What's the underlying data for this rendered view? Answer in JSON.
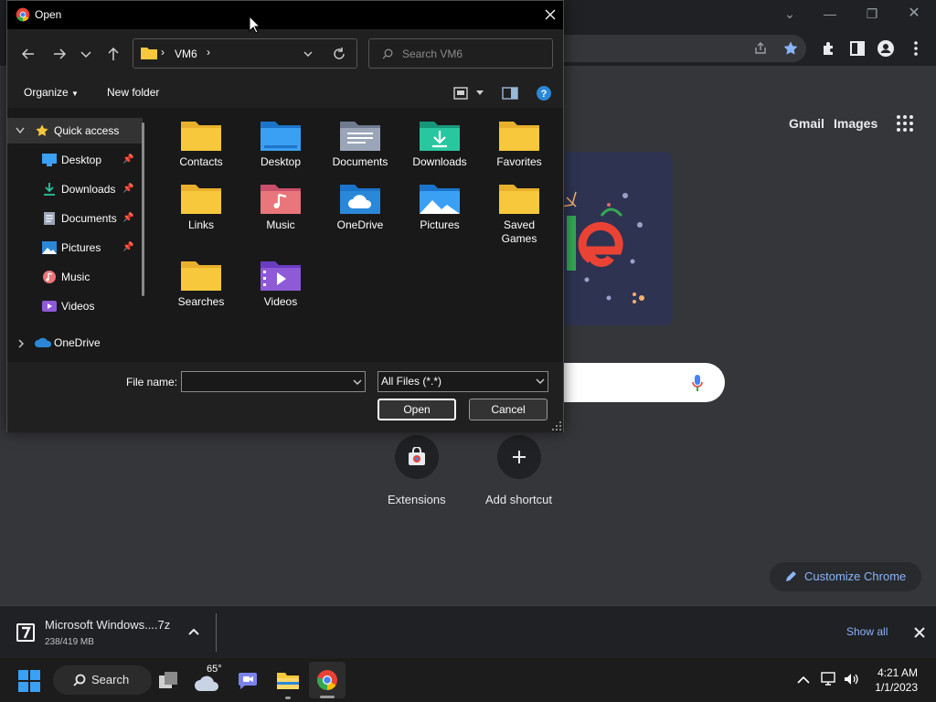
{
  "colors": {
    "accent_blue": "#8ab4f8",
    "folder_yellow": "#f8c83c",
    "chrome_dark": "#202124",
    "dialog_bg": "#202020",
    "pane_bg": "#191919"
  },
  "chrome": {
    "header_links": [
      "Gmail",
      "Images"
    ],
    "shortcuts": [
      {
        "label": "Extensions",
        "icon": "chrome-web-store-icon"
      },
      {
        "label": "Add shortcut",
        "icon": "plus-icon"
      }
    ],
    "customize_label": "Customize Chrome",
    "download": {
      "name": "Microsoft Windows....7z",
      "size": "238/419 MB",
      "show_all": "Show all"
    }
  },
  "dialog": {
    "title": "Open",
    "address": {
      "crumbs": [
        "VM6"
      ]
    },
    "search_placeholder": "Search VM6",
    "commands": {
      "organize": "Organize",
      "new_folder": "New folder"
    },
    "nav": {
      "quick_access": "Quick access",
      "items": [
        {
          "label": "Desktop",
          "pinned": true,
          "icon": "desktop-icon"
        },
        {
          "label": "Downloads",
          "pinned": true,
          "icon": "download-icon"
        },
        {
          "label": "Documents",
          "pinned": true,
          "icon": "documents-icon"
        },
        {
          "label": "Pictures",
          "pinned": true,
          "icon": "pictures-icon"
        },
        {
          "label": "Music",
          "pinned": false,
          "icon": "music-icon"
        },
        {
          "label": "Videos",
          "pinned": false,
          "icon": "videos-icon"
        }
      ],
      "onedrive": "OneDrive"
    },
    "folders": [
      {
        "label": "Contacts",
        "kind": "plain"
      },
      {
        "label": "Desktop",
        "kind": "desktop"
      },
      {
        "label": "Documents",
        "kind": "documents"
      },
      {
        "label": "Downloads",
        "kind": "downloads"
      },
      {
        "label": "Favorites",
        "kind": "plain"
      },
      {
        "label": "Links",
        "kind": "plain"
      },
      {
        "label": "Music",
        "kind": "music"
      },
      {
        "label": "OneDrive",
        "kind": "onedrive"
      },
      {
        "label": "Pictures",
        "kind": "pictures"
      },
      {
        "label": "Saved Games",
        "kind": "plain"
      },
      {
        "label": "Searches",
        "kind": "plain"
      },
      {
        "label": "Videos",
        "kind": "videos"
      }
    ],
    "file_name_label": "File name:",
    "file_name_value": "",
    "filter": "All Files (*.*)",
    "open_label": "Open",
    "cancel_label": "Cancel"
  },
  "taskbar": {
    "search_label": "Search",
    "weather": "65°",
    "time": "4:21 AM",
    "date": "1/1/2023"
  }
}
